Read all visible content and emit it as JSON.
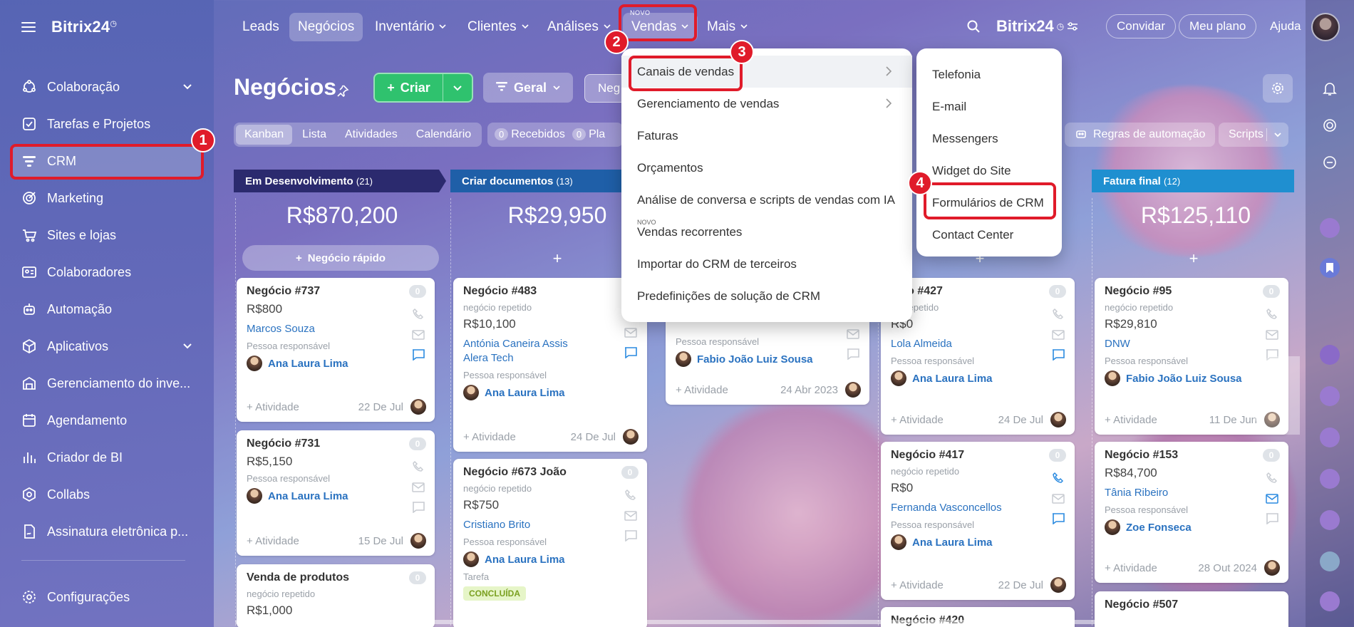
{
  "app": {
    "logo": "Bitrix24",
    "logo_mark": "◷"
  },
  "sidebar": {
    "items": [
      {
        "label": "Colaboração",
        "icon": "collaboration-icon",
        "has_chevron": true
      },
      {
        "label": "Tarefas e Projetos",
        "icon": "tasks-icon"
      },
      {
        "label": "CRM",
        "icon": "crm-icon",
        "active": true
      },
      {
        "label": "Marketing",
        "icon": "marketing-icon"
      },
      {
        "label": "Sites e lojas",
        "icon": "cart-icon"
      },
      {
        "label": "Colaboradores",
        "icon": "employees-icon"
      },
      {
        "label": "Automação",
        "icon": "robot-icon"
      },
      {
        "label": "Aplicativos",
        "icon": "apps-icon",
        "has_chevron": true
      },
      {
        "label": "Gerenciamento do inve...",
        "icon": "inventory-icon"
      },
      {
        "label": "Agendamento",
        "icon": "calendar-icon"
      },
      {
        "label": "Criador de BI",
        "icon": "bi-icon"
      },
      {
        "label": "Collabs",
        "icon": "collabs-icon"
      },
      {
        "label": "Assinatura eletrônica p...",
        "icon": "signature-icon"
      }
    ],
    "settings_label": "Configurações"
  },
  "topnav": {
    "items": [
      {
        "label": "Leads"
      },
      {
        "label": "Negócios",
        "active": true
      },
      {
        "label": "Inventário",
        "dropdown": true
      },
      {
        "label": "Clientes",
        "dropdown": true
      },
      {
        "label": "Análises",
        "dropdown": true
      },
      {
        "label": "Vendas",
        "dropdown": true,
        "novo": "NOVO"
      },
      {
        "label": "Mais",
        "dropdown": true
      }
    ],
    "brand": "Bitrix24",
    "invite": "Convidar",
    "plan": "Meu plano",
    "help": "Ajuda"
  },
  "header": {
    "title": "Negócios",
    "create": "Criar",
    "general": "Geral",
    "search_value": "Neg"
  },
  "views": [
    "Kanban",
    "Lista",
    "Atividades",
    "Calendário"
  ],
  "counters": [
    {
      "n": "0",
      "label": "Recebidos"
    },
    {
      "n": "0",
      "label": "Pla"
    }
  ],
  "automation": "Regras de automação",
  "scripts": "Scripts",
  "menu_vendas": {
    "items": [
      {
        "label": "Canais de vendas",
        "arrow": true,
        "highlighted": true
      },
      {
        "label": "Gerenciamento de vendas",
        "arrow": true
      },
      {
        "label": "Faturas"
      },
      {
        "label": "Orçamentos"
      },
      {
        "label": "Análise de conversa e scripts de vendas com IA"
      },
      {
        "label": "Vendas recorrentes",
        "novo": "NOVO"
      },
      {
        "label": "Importar do CRM de terceiros"
      },
      {
        "label": "Predefinições de solução de CRM"
      }
    ]
  },
  "menu_canais": {
    "items": [
      "Telefonia",
      "E-mail",
      "Messengers",
      "Widget do Site",
      "Formulários de CRM",
      "Contact Center"
    ]
  },
  "callouts": [
    "1",
    "2",
    "3",
    "4"
  ],
  "columns": [
    {
      "name": "Em Desenvolvimento",
      "count": "(21)",
      "sum": "R$870,200",
      "quick": "Negócio rápido",
      "color": "#2b2a6e"
    },
    {
      "name": "Criar documentos",
      "count": "(13)",
      "sum": "R$29,950",
      "color": "#1f5fa8"
    },
    {
      "name": "Fatura final",
      "count": "(12)",
      "sum": "R$125,110",
      "color": "#1f8fd0"
    }
  ],
  "plus": "+",
  "badge_zero": "0",
  "activity": "+ Atividade",
  "responsible": "Pessoa responsável",
  "repeat": "negócio repetido",
  "cards": {
    "c737": {
      "title": "Negócio #737",
      "amount": "R$800",
      "client": "Marcos Souza",
      "person": "Ana Laura Lima",
      "date": "22 De Jul"
    },
    "c731": {
      "title": "Negócio #731",
      "amount": "R$5,150",
      "person": "Ana Laura Lima",
      "date": "15 De Jul"
    },
    "cvp": {
      "title": "Venda de produtos",
      "amount": "R$1,000"
    },
    "c483": {
      "title": "Negócio #483",
      "amount": "R$10,100",
      "client": "Antónia Caneira Assis",
      "client2": "Alera Tech",
      "person": "Ana Laura Lima",
      "date": "24 De Jul"
    },
    "c673": {
      "title": "Negócio #673 João",
      "amount": "R$750",
      "client": "Cristiano Brito",
      "person": "Ana Laura Lima",
      "task": "Tarefa",
      "status": "CONCLUÍDA"
    },
    "cmid": {
      "person": "Fabio João Luiz Sousa",
      "date": "24 Abr 2023"
    },
    "c427": {
      "title": "ócio #427",
      "sub": "cio repetido",
      "amount": "R$0",
      "client": "Lola Almeida",
      "person": "Ana Laura Lima",
      "date": "24 De Jul"
    },
    "c417": {
      "title": "Negócio #417",
      "amount": "R$0",
      "client": "Fernanda Vasconcellos",
      "person": "Ana Laura Lima",
      "date": "22 De Jul"
    },
    "c95": {
      "title": "Negócio #95",
      "amount": "R$29,810",
      "client": "DNW",
      "person": "Fabio João Luiz Sousa",
      "date": "11 De Jun"
    },
    "c153": {
      "title": "Negócio #153",
      "amount": "R$84,700",
      "client": "Tânia Ribeiro",
      "person": "Zoe Fonseca",
      "date": "28 Out 2024"
    },
    "c507": {
      "title": "Negócio #507"
    },
    "c420": {
      "title": "Negócio #420"
    }
  },
  "colors": {
    "accent_green": "#2fc26e",
    "callout_red": "#e01b2a",
    "link_blue": "#2a72c0"
  }
}
